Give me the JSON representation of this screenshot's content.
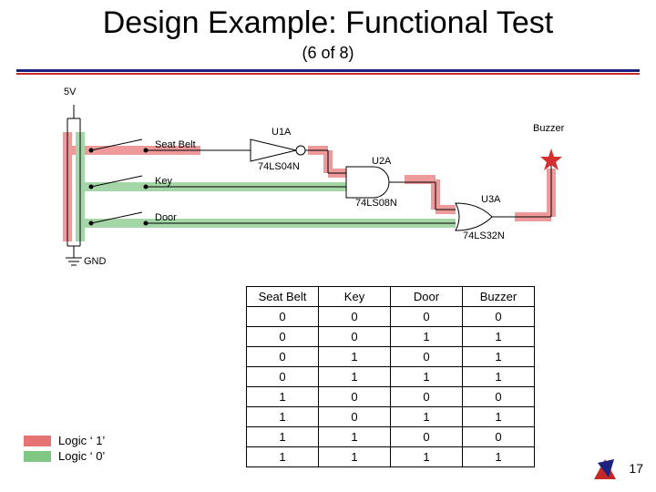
{
  "title": "Design Example: Functional Test",
  "subtitle": "(6 of 8)",
  "schematic": {
    "v5": "5V",
    "gnd": "GND",
    "inputs": {
      "seatbelt": "Seat Belt",
      "key": "Key",
      "door": "Door"
    },
    "gates": {
      "u1a": "U1A",
      "u1a_pn": "74LS04N",
      "u2a": "U2A",
      "u2a_pn": "74LS08N",
      "u3a": "U3A",
      "u3a_pn": "74LS32N"
    },
    "output": "Buzzer"
  },
  "legend": {
    "logic1": "Logic ‘ 1’",
    "logic0": "Logic ‘ 0’"
  },
  "table": {
    "headers": [
      "Seat Belt",
      "Key",
      "Door",
      "Buzzer"
    ],
    "rows": [
      [
        0,
        0,
        0,
        0
      ],
      [
        0,
        0,
        1,
        1
      ],
      [
        0,
        1,
        0,
        1
      ],
      [
        0,
        1,
        1,
        1
      ],
      [
        1,
        0,
        0,
        0
      ],
      [
        1,
        0,
        1,
        1
      ],
      [
        1,
        1,
        0,
        0
      ],
      [
        1,
        1,
        1,
        1
      ]
    ]
  },
  "page_number": "17",
  "chart_data": {
    "type": "table",
    "title": "Functional Test Truth Table",
    "columns": [
      "Seat Belt",
      "Key",
      "Door",
      "Buzzer"
    ],
    "data": [
      {
        "Seat Belt": 0,
        "Key": 0,
        "Door": 0,
        "Buzzer": 0
      },
      {
        "Seat Belt": 0,
        "Key": 0,
        "Door": 1,
        "Buzzer": 1
      },
      {
        "Seat Belt": 0,
        "Key": 1,
        "Door": 0,
        "Buzzer": 1
      },
      {
        "Seat Belt": 0,
        "Key": 1,
        "Door": 1,
        "Buzzer": 1
      },
      {
        "Seat Belt": 1,
        "Key": 0,
        "Door": 0,
        "Buzzer": 0
      },
      {
        "Seat Belt": 1,
        "Key": 0,
        "Door": 1,
        "Buzzer": 1
      },
      {
        "Seat Belt": 1,
        "Key": 1,
        "Door": 0,
        "Buzzer": 0
      },
      {
        "Seat Belt": 1,
        "Key": 1,
        "Door": 1,
        "Buzzer": 1
      }
    ]
  }
}
